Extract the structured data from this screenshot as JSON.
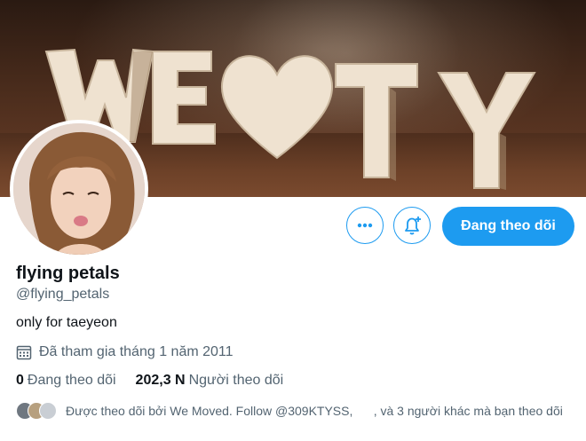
{
  "banner": {
    "letters": "WE ♥ TY"
  },
  "profile": {
    "name": "flying petals",
    "handle": "@flying_petals",
    "bio": "only for taeyeon",
    "joined": "Đã tham gia tháng 1 năm 2011"
  },
  "actions": {
    "more_icon": "ellipsis-icon",
    "bell_icon": "bell-plus-icon",
    "follow_label": "Đang theo dõi"
  },
  "stats": {
    "following_count": "0",
    "following_label": "Đang theo dõi",
    "followers_count": "202,3 N",
    "followers_label": "Người theo dõi"
  },
  "followed_by": {
    "text": "Được theo dõi bởi We Moved. Follow @309KTYSS,      , và 3 người khác mà bạn theo dõi"
  },
  "colors": {
    "accent": "#1d9bf0",
    "secondary_text": "#536471",
    "primary_text": "#0f1419"
  }
}
